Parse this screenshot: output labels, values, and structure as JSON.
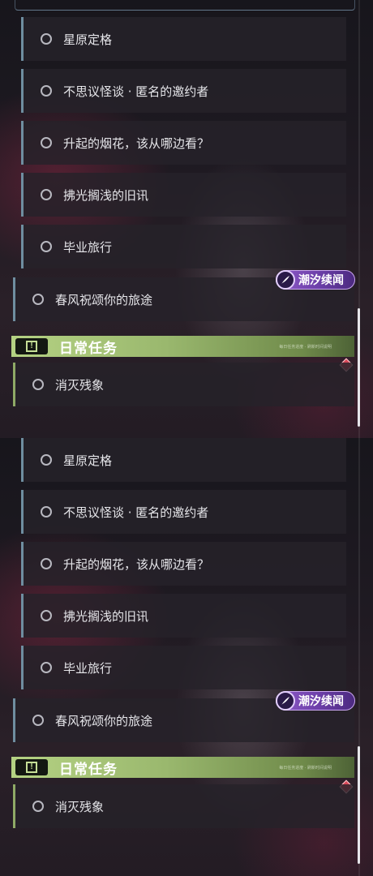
{
  "quest_list": {
    "sub_quests": [
      {
        "label": "星原定格"
      },
      {
        "label": "不思议怪谈 · 匿名的邀约者"
      },
      {
        "label": "升起的烟花，该从哪边看？"
      },
      {
        "label": "拂光搁浅的旧讯"
      },
      {
        "label": "毕业旅行"
      }
    ],
    "main_quest": {
      "label": "春风祝颂你的旅途"
    },
    "event_badge": {
      "text": "潮汐续闻",
      "icon": "feather-icon"
    },
    "daily_section": {
      "title": "日常任务",
      "icon": "alert-icon",
      "fine_print": "每日任务进度 · 刷新时间说明"
    },
    "daily_quests": [
      {
        "label": "消灭残象"
      }
    ],
    "accent_colors": {
      "story": "#6f8ea0",
      "daily": "#8faa66",
      "badge": "#8e5ac8",
      "tracker": "#d84858"
    }
  }
}
